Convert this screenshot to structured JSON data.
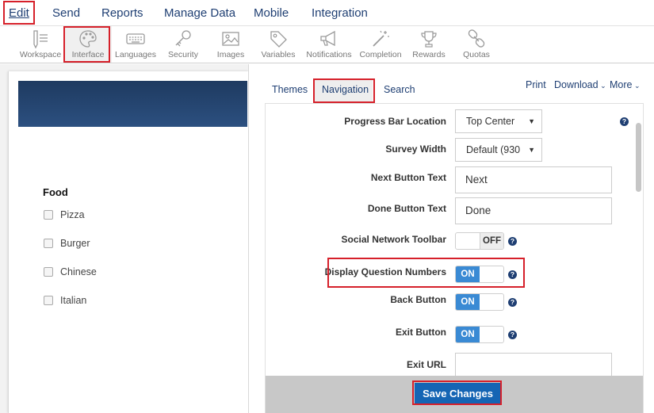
{
  "top_menu": {
    "items": [
      "Edit",
      "Send",
      "Reports",
      "Manage Data",
      "Mobile",
      "Integration"
    ]
  },
  "toolbar": {
    "items": [
      {
        "label": "Workspace",
        "icon": "pencil-icon"
      },
      {
        "label": "Interface",
        "icon": "palette-icon"
      },
      {
        "label": "Languages",
        "icon": "keyboard-icon"
      },
      {
        "label": "Security",
        "icon": "key-icon"
      },
      {
        "label": "Images",
        "icon": "image-icon"
      },
      {
        "label": "Variables",
        "icon": "tag-icon"
      },
      {
        "label": "Notifications",
        "icon": "megaphone-icon"
      },
      {
        "label": "Completion",
        "icon": "magic-wand-icon"
      },
      {
        "label": "Rewards",
        "icon": "trophy-icon"
      },
      {
        "label": "Quotas",
        "icon": "chain-icon"
      }
    ]
  },
  "preview": {
    "question_title": "Food",
    "options": [
      "Pizza",
      "Burger",
      "Chinese",
      "Italian"
    ],
    "header_color": "#1e3a60"
  },
  "tabs": [
    "Themes",
    "Navigation",
    "Search"
  ],
  "right_links": {
    "print": "Print",
    "download": "Download",
    "more": "More"
  },
  "settings": {
    "progress_bar_location": {
      "label": "Progress Bar Location",
      "value": "Top Center"
    },
    "survey_width": {
      "label": "Survey Width",
      "value": "Default (930"
    },
    "next_button_text": {
      "label": "Next Button Text",
      "value": "Next"
    },
    "done_button_text": {
      "label": "Done Button Text",
      "value": "Done"
    },
    "social_network_toolbar": {
      "label": "Social Network Toolbar",
      "state": "OFF"
    },
    "display_question_numbers": {
      "label": "Display Question Numbers",
      "state": "ON"
    },
    "back_button": {
      "label": "Back Button",
      "state": "ON"
    },
    "exit_button": {
      "label": "Exit Button",
      "state": "ON"
    },
    "exit_url": {
      "label": "Exit URL",
      "value": ""
    }
  },
  "help_glyph": "?",
  "save_button": "Save Changes",
  "colors": {
    "accent": "#1f3f73",
    "highlight_red": "#d6202a",
    "toggle_on": "#3a8ad4",
    "save_button": "#1565b4"
  }
}
